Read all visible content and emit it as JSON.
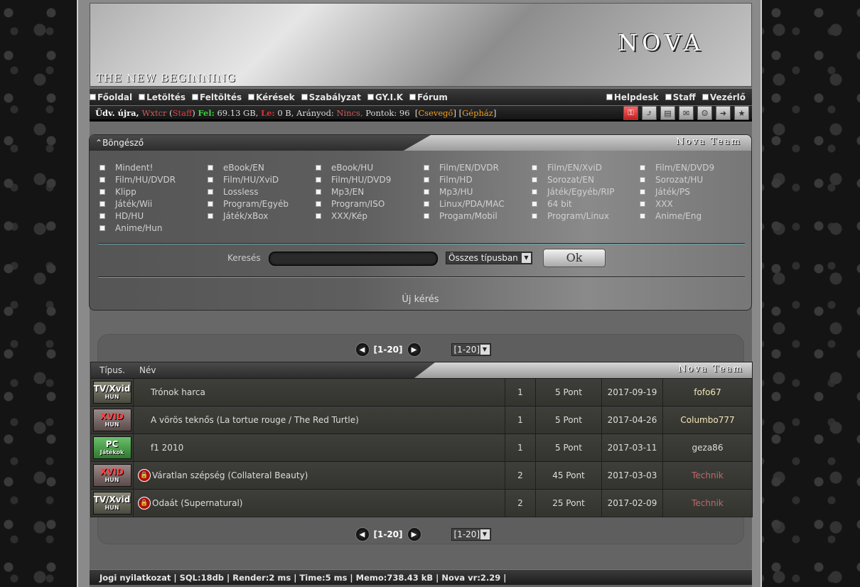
{
  "banner": {
    "logo": "NOVA",
    "slogan": "THE NEW BEGINNING"
  },
  "nav": {
    "left": [
      "Főoldal",
      "Letöltés",
      "Feltöltés",
      "Kérések",
      "Szabályzat",
      "GY.I.K",
      "Fórum"
    ],
    "right": [
      "Helpdesk",
      "Staff",
      "Vezérlő"
    ]
  },
  "status": {
    "greet": "Üdv. újra,",
    "username": "Wxtcr",
    "role": "Staff",
    "up_label": "Fel:",
    "up_value": "69.13 GB,",
    "down_label": "Le:",
    "down_value": "0 B,",
    "ratio_label": "Arányod:",
    "ratio_value": "Nincs,",
    "points": "Pontok: 96",
    "chat": "Csevegő",
    "machine": "Gépház",
    "icons": [
      "key-icon",
      "chart-icon",
      "book-icon",
      "mail-icon",
      "users-icon",
      "arrow-right-icon",
      "star-icon"
    ]
  },
  "browser": {
    "title": "Böngésző",
    "team": "Nova Team",
    "categories": [
      "Mindent!",
      "eBook/EN",
      "eBook/HU",
      "Film/EN/DVDR",
      "Film/EN/XviD",
      "Film/EN/DVD9",
      "Film/HU/DVDR",
      "Film/HU/XviD",
      "Film/HU/DVD9",
      "Film/HD",
      "Sorozat/EN",
      "Sorozat/HU",
      "Klipp",
      "Lossless",
      "Mp3/EN",
      "Mp3/HU",
      "Játék/Egyéb/RIP",
      "Játék/PS",
      "Játék/Wii",
      "Program/Egyéb",
      "Program/ISO",
      "Linux/PDA/MAC",
      "64 bit",
      "XXX",
      "HD/HU",
      "Játék/xBox",
      "XXX/Kép",
      "Progam/Mobil",
      "Program/Linux",
      "Anime/Eng",
      "Anime/Hun"
    ],
    "search_label": "Keresés",
    "search_value": "",
    "type_select": "Összes típusban",
    "ok_label": "Ok",
    "new_request": "Új kérés"
  },
  "pager": {
    "range": "[1-20]",
    "select": "[1-20]"
  },
  "table": {
    "col_type": "Típus.",
    "col_name": "Név",
    "team": "Nova Team",
    "rows": [
      {
        "badge": "TV/Xvid",
        "badge_sub": "HUN",
        "kind": "tv",
        "locked": false,
        "name": "Trónok harca",
        "num": "1",
        "points": "5 Pont",
        "date": "2017-09-19",
        "user": "fofo67",
        "user_style": "yellow"
      },
      {
        "badge": "XVID",
        "badge_sub": "HUN",
        "kind": "xvid",
        "locked": false,
        "name": "A vörös teknős (La tortue rouge / The Red Turtle)",
        "num": "1",
        "points": "5 Pont",
        "date": "2017-04-26",
        "user": "Columbo777",
        "user_style": "yellow"
      },
      {
        "badge": "PC",
        "badge_sub": "Játékok",
        "kind": "pc",
        "locked": false,
        "name": "f1 2010",
        "num": "1",
        "points": "5 Pont",
        "date": "2017-03-11",
        "user": "geza86",
        "user_style": "normal"
      },
      {
        "badge": "XVID",
        "badge_sub": "HUN",
        "kind": "xvid",
        "locked": true,
        "name": "Váratlan szépség (Collateral Beauty)",
        "num": "2",
        "points": "45 Pont",
        "date": "2017-03-03",
        "user": "Technik",
        "user_style": "tech"
      },
      {
        "badge": "TV/Xvid",
        "badge_sub": "HUN",
        "kind": "tv",
        "locked": true,
        "name": "Odaát (Supernatural)",
        "num": "2",
        "points": "25 Pont",
        "date": "2017-02-09",
        "user": "Technik",
        "user_style": "tech"
      }
    ]
  },
  "footer": "Jogi nyilatkozat | SQL:18db | Render:2 ms | Time:5 ms | Memo:738.43 kB | Nova vr:2.29 |"
}
